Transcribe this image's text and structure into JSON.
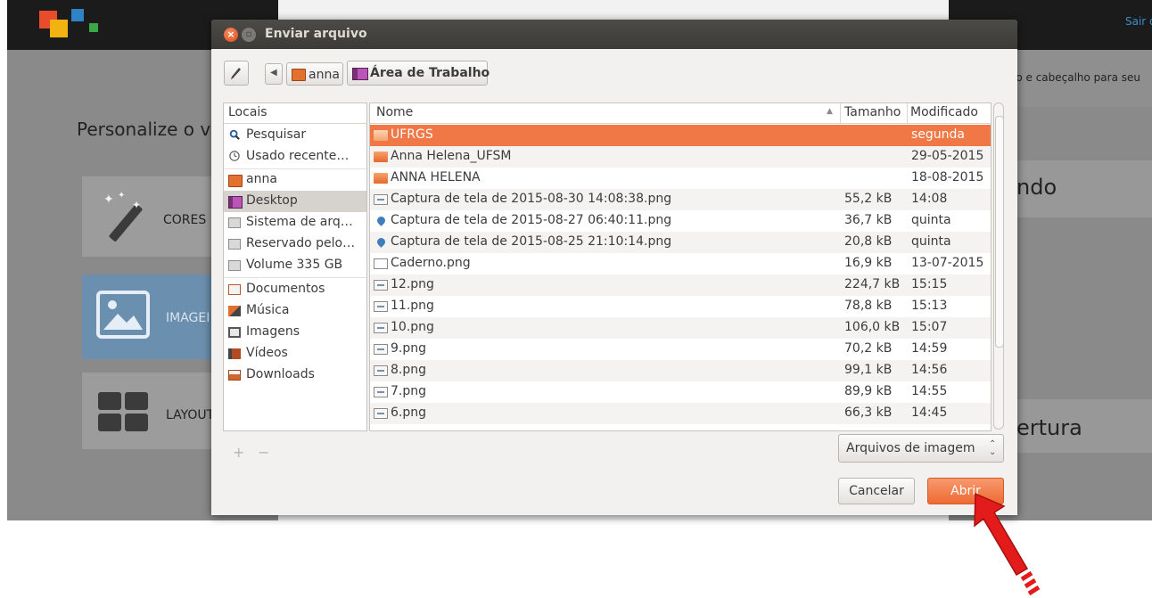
{
  "background_page": {
    "logout_link": "Sair d",
    "hint_text": "lo e cabeçalho para seu",
    "heading": "Personalize o v",
    "right_title_1": "ndo",
    "right_title_2": "ertura",
    "tiles": [
      {
        "label": "CORES",
        "icon": "magic-wand-icon"
      },
      {
        "label": "IMAGEI",
        "icon": "image-icon"
      },
      {
        "label": "LAYOUT",
        "icon": "layout-grid-icon"
      }
    ],
    "logo_colors": [
      "#e84c2a",
      "#f2b211",
      "#2e83c7",
      "#3aa845"
    ]
  },
  "dialog": {
    "title": "Enviar arquivo",
    "breadcrumb": [
      "anna",
      "Área de Trabalho"
    ],
    "sidebar": {
      "header": "Locais",
      "items": [
        {
          "label": "Pesquisar",
          "icon": "search-icon"
        },
        {
          "label": "Usado recente…",
          "icon": "clock-icon"
        },
        {
          "label": "anna",
          "icon": "home-folder-icon"
        },
        {
          "label": "Desktop",
          "icon": "desktop-icon",
          "selected": true
        },
        {
          "label": "Sistema de arq…",
          "icon": "drive-icon"
        },
        {
          "label": "Reservado pelo…",
          "icon": "drive-icon"
        },
        {
          "label": "Volume 335 GB",
          "icon": "drive-icon"
        },
        {
          "label": "Documentos",
          "icon": "documents-icon"
        },
        {
          "label": "Música",
          "icon": "music-icon"
        },
        {
          "label": "Imagens",
          "icon": "pictures-icon"
        },
        {
          "label": "Vídeos",
          "icon": "videos-icon"
        },
        {
          "label": "Downloads",
          "icon": "downloads-icon"
        }
      ],
      "add_label": "+",
      "remove_label": "−"
    },
    "columns": {
      "name": "Nome",
      "size": "Tamanho",
      "modified": "Modificado"
    },
    "files": [
      {
        "name": "UFRGS",
        "size": "",
        "modified": "segunda",
        "type": "folder",
        "selected": true
      },
      {
        "name": "Anna Helena_UFSM",
        "size": "",
        "modified": "29-05-2015",
        "type": "folder"
      },
      {
        "name": "ANNA HELENA",
        "size": "",
        "modified": "18-08-2015",
        "type": "folder"
      },
      {
        "name": "Captura de tela de 2015-08-30 14:08:38.png",
        "size": "55,2 kB",
        "modified": "14:08",
        "type": "image"
      },
      {
        "name": "Captura de tela de 2015-08-27 06:40:11.png",
        "size": "36,7 kB",
        "modified": "quinta",
        "type": "drop"
      },
      {
        "name": "Captura de tela de 2015-08-25 21:10:14.png",
        "size": "20,8 kB",
        "modified": "quinta",
        "type": "drop"
      },
      {
        "name": "Caderno.png",
        "size": "16,9 kB",
        "modified": "13-07-2015",
        "type": "doc"
      },
      {
        "name": "12.png",
        "size": "224,7 kB",
        "modified": "15:15",
        "type": "image"
      },
      {
        "name": "11.png",
        "size": "78,8 kB",
        "modified": "15:13",
        "type": "image"
      },
      {
        "name": "10.png",
        "size": "106,0 kB",
        "modified": "15:07",
        "type": "image"
      },
      {
        "name": "9.png",
        "size": "70,2 kB",
        "modified": "14:59",
        "type": "image"
      },
      {
        "name": "8.png",
        "size": "99,1 kB",
        "modified": "14:56",
        "type": "image"
      },
      {
        "name": "7.png",
        "size": "89,9 kB",
        "modified": "14:55",
        "type": "image"
      },
      {
        "name": "6.png",
        "size": "66,3 kB",
        "modified": "14:45",
        "type": "image"
      }
    ],
    "filter": "Arquivos de imagem",
    "cancel_label": "Cancelar",
    "open_label": "Abrir",
    "accent_color": "#f07746"
  },
  "annotation": {
    "pointer": "red-arrow-icon",
    "color": "#e31b1b"
  }
}
